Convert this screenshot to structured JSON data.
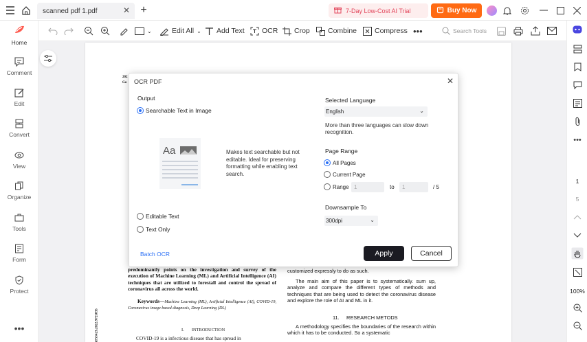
{
  "titlebar": {
    "tab_name": "scanned pdf 1.pdf",
    "promo": "7-Day Low-Cost AI Trial",
    "buy": "Buy Now"
  },
  "toolbar": {
    "edit_all": "Edit All",
    "add_text": "Add Text",
    "ocr": "OCR",
    "crop": "Crop",
    "combine": "Combine",
    "compress": "Compress",
    "search_placeholder": "Search Tools"
  },
  "sidebar": {
    "items": [
      {
        "label": "Home"
      },
      {
        "label": "Comment"
      },
      {
        "label": "Edit"
      },
      {
        "label": "Convert"
      },
      {
        "label": "View"
      },
      {
        "label": "Organize"
      },
      {
        "label": "Tools"
      },
      {
        "label": "Form"
      },
      {
        "label": "Protect"
      }
    ]
  },
  "rightbar": {
    "page_current": "1",
    "page_total": "5",
    "zoom": "100%"
  },
  "dialog": {
    "title": "OCR PDF",
    "output_label": "Output",
    "opt_searchable": "Searchable Text in Image",
    "searchable_desc": "Makes text searchable but not editable. Ideal for preserving formatting while enabling text search.",
    "preview_text": "Aa",
    "opt_editable": "Editable Text",
    "opt_textonly": "Text Only",
    "lang_label": "Selected Language",
    "lang_value": "English",
    "lang_note": "More than three languages can slow down recognition.",
    "range_label": "Page Range",
    "range_all": "All Pages",
    "range_current": "Current Page",
    "range_custom": "Range",
    "range_from": "1",
    "range_to_word": "to",
    "range_to": "1",
    "range_of": "/ 5",
    "downsample_label": "Downsample To",
    "downsample_value": "300dpi",
    "batch": "Batch OCR",
    "apply": "Apply",
    "cancel": "Cancel"
  },
  "document": {
    "header_frag1": "202",
    "header_frag2": "Go",
    "left_col": "predominantly points on the investigation and survey of the execution of Machine Learning (ML) and Artificial Intelligence (AI) techniques that are utilized to forestall and control the spread of coronavirus all across the world.",
    "keywords_label": "Keywords—",
    "keywords_text": "Machine Learning (ML), Artificial Intelligence (AI), COVID-19, Coronavirus image based diagnosis, Deep Learning (DL)",
    "intro_heading": "I.       INTRODUCTION",
    "covid_frag": "COVID-19 is a infectious disease that has spread in",
    "right_col1": "customized expressly to do as such.",
    "right_col2": "The main aim of this paper is to systematically. sum up, analyze and compare the different types of methods and techniques that are being used to detect the coronavirus disease and explore the role of AI and ML in it.",
    "research_heading": "11.     RESEARCH METODS",
    "right_col3": "A methodology specifies the boundaries of the research within which it has to be conducted. So a systematic",
    "side_code": "ICONAT53423.2022.9725835"
  }
}
